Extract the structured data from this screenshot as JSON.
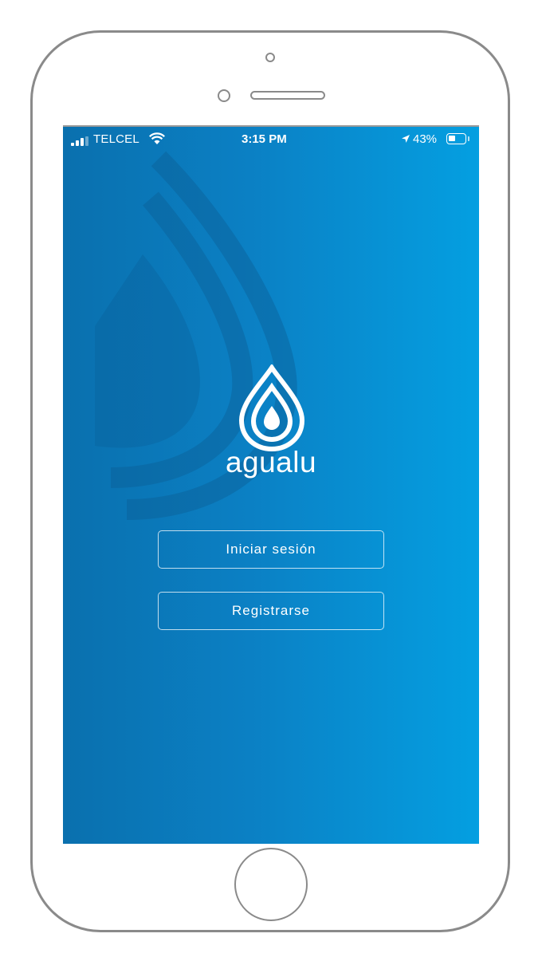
{
  "status_bar": {
    "carrier": "TELCEL",
    "time": "3:15 PM",
    "battery_percent": "43%",
    "battery_level": 0.43,
    "signal_bars_filled": 3,
    "icons": [
      "signal-icon",
      "wifi-icon",
      "location-arrow-icon",
      "battery-icon"
    ]
  },
  "app": {
    "logo_text": "agualu",
    "logo_icon": "water-drop-icon"
  },
  "buttons": {
    "login_label": "Iniciar sesión",
    "register_label": "Registrarse"
  },
  "colors": {
    "gradient_start": "#0a70ae",
    "gradient_end": "#049fe1",
    "foreground": "#ffffff",
    "device_frame": "#8a8a8a"
  }
}
